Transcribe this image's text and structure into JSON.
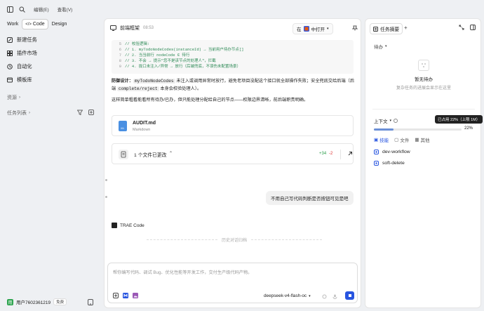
{
  "sidebar": {
    "menu_edit": "编辑(E)",
    "menu_view": "查看(V)",
    "modes": [
      "Work",
      "Code",
      "Design"
    ],
    "items": [
      {
        "label": "新建任务",
        "icon": "new-task-icon"
      },
      {
        "label": "插件市场",
        "icon": "plugin-market-icon"
      },
      {
        "label": "自动化",
        "icon": "automation-icon"
      },
      {
        "label": "模板库",
        "icon": "template-icon"
      }
    ],
    "section_resources": "资源",
    "section_tasks": "任务列表",
    "user_name": "用户7602361219",
    "user_initial": "用",
    "user_badge": "免费"
  },
  "main": {
    "title": "前端框架",
    "time": "08:53",
    "open_prefix": "在",
    "open_label": "中打开",
    "code_lines": [
      {
        "n": "5",
        "t": "// 校验逻辑:"
      },
      {
        "n": "6",
        "t": "// 1. myTodoNodeCodes(instanceId) → 当前用户待办节点[]"
      },
      {
        "n": "7",
        "t": "// 2. 当当前行 nodeCode ∈ 待行"
      },
      {
        "n": "8",
        "t": "// 3. 不会 → 提示\"您不是该节点的处理人\"，拦截"
      },
      {
        "n": "9",
        "t": "// 4. 拢口未注入/异常 → 放行（后端兜底，不误伤未配置场景）"
      }
    ],
    "para1_bold": "防御设计：",
    "para1_code1": "myTodoNodeCodes",
    "para1_text1": " 未注入或调用异常时放行，避免老项目没配这个接口就全部操作失败；安全兜底交给后端（后端 ",
    "para1_code2": "complete/reject",
    "para1_text2": " 本身会校验处理人）。",
    "para2": "这样简单粗看能看所有待办/已办，但只能处理分配给自己的节点——权限边界清晰，前后端职责明确。",
    "file_name": "AUDIT.md",
    "file_type": "Markdown",
    "file_badge": "M↓",
    "changes_label": "1 个文件已更改",
    "added": "+34",
    "removed": "-2",
    "user_message": "不用自己写代码判断是否按钮可见是吧",
    "assistant_name": "TRAE Code",
    "history_label": "历史对话归档",
    "input_placeholder": "帮你编写代码、调试 Bug、优化性能等开发工作，交付生产级代码产物。",
    "model": "deepseek-v4-flash-oc"
  },
  "right": {
    "tab": "任务摘要",
    "filter": "待办",
    "empty_title": "暂无待办",
    "empty_desc": "复杂任务的进展会显示在这里",
    "context_label": "上下文",
    "tooltip": "已占用 22%（上限 1M）",
    "usage_pct": "22%",
    "usage_fraction": 0.22,
    "tabs": [
      "技能",
      "文件",
      "其他"
    ],
    "skills": [
      "dev-workflow",
      "soft-delete"
    ]
  },
  "colors": {
    "accent": "#2855e0",
    "added": "#2a9d4a",
    "removed": "#d33333",
    "user_green": "#2ea44f"
  }
}
